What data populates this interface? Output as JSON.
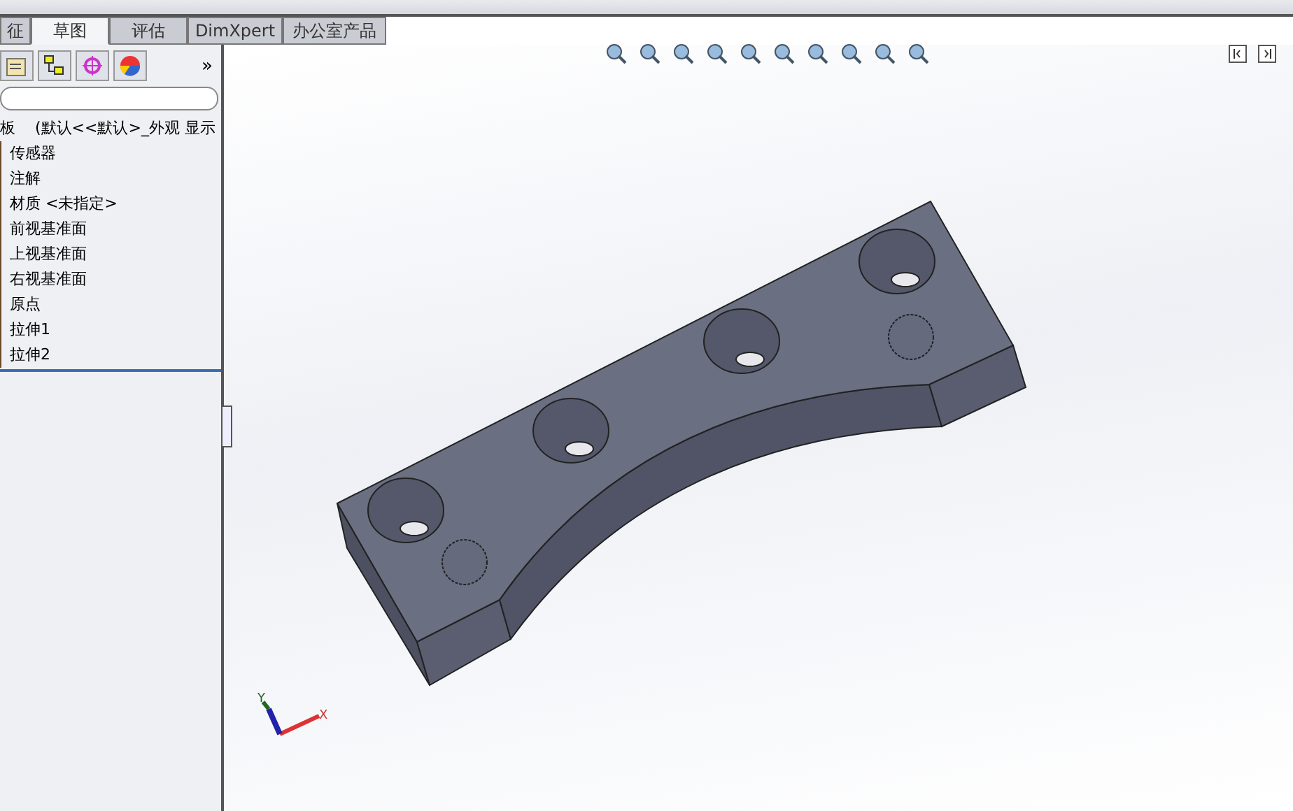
{
  "tabs": [
    {
      "label": "征",
      "selected": false
    },
    {
      "label": "草图",
      "selected": true
    },
    {
      "label": "评估",
      "selected": false
    },
    {
      "label": "DimXpert",
      "selected": false
    },
    {
      "label": "办公室产品",
      "selected": false
    }
  ],
  "panel": {
    "more": "»",
    "header_part": "板",
    "header_config": "(默认<<默认>_外观 显示",
    "tree": [
      {
        "label": "传感器"
      },
      {
        "label": "注解"
      },
      {
        "label": "材质 <未指定>"
      },
      {
        "label": "前视基准面"
      },
      {
        "label": "上视基准面"
      },
      {
        "label": "右视基准面"
      },
      {
        "label": "原点"
      },
      {
        "label": "拉伸1"
      },
      {
        "label": "拉伸2"
      }
    ]
  },
  "viewport": {
    "triad": {
      "x_label": "X",
      "y_label": "Y"
    }
  }
}
